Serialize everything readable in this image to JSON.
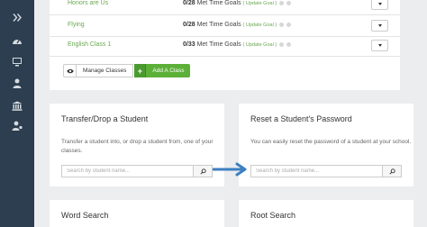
{
  "sidebar": {
    "icons": [
      {
        "name": "chevron-double-right-icon"
      },
      {
        "name": "dashboard-gauge-icon"
      },
      {
        "name": "monitor-icon"
      },
      {
        "name": "user-icon"
      },
      {
        "name": "institution-icon"
      },
      {
        "name": "user-settings-icon"
      }
    ]
  },
  "classes": [
    {
      "name": "Honors are Us",
      "count": "0/28",
      "label": "Met Time Goals",
      "link": "( Update Goal )"
    },
    {
      "name": "Flying",
      "count": "0/28",
      "label": "Met Time Goals",
      "link": "( Update Goal )"
    },
    {
      "name": "English Class 1",
      "count": "0/33",
      "label": "Met Time Goals",
      "link": "( Update Goal )"
    }
  ],
  "actions": {
    "manage_label": "Manage Classes",
    "plus_label": "+",
    "add_label": "Add A Class"
  },
  "transfer_card": {
    "title": "Transfer/Drop a Student",
    "description": "Transfer a student into, or drop a student from, one of your classes.",
    "placeholder": "Search by student name..."
  },
  "reset_card": {
    "title": "Reset a Student's Password",
    "description": "You can easily reset the password of a student at your school.",
    "placeholder": "Search by student name..."
  },
  "word_search_card": {
    "title": "Word Search"
  },
  "root_search_card": {
    "title": "Root Search"
  },
  "colors": {
    "sidebar": "#2c3e50",
    "accent_green": "#5cb038",
    "link_green": "#6aa84f",
    "arrow_blue": "#3d7fc1"
  }
}
